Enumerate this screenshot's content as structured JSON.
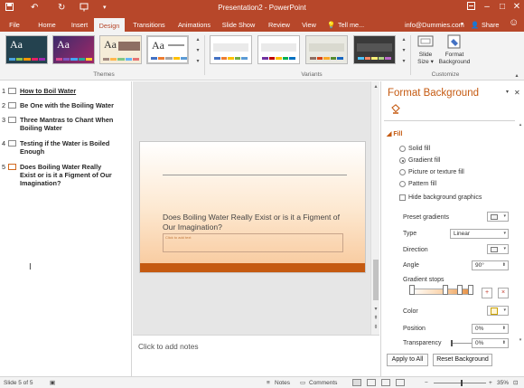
{
  "titlebar": {
    "title": "Presentation2 - PowerPoint",
    "qa_icons": [
      "save-icon",
      "undo-icon",
      "redo-icon",
      "present-icon",
      "customize-icon"
    ],
    "window_controls": [
      "restore-icon",
      "minimize-icon",
      "maximize-icon",
      "close-icon"
    ]
  },
  "tabs": [
    "File",
    "Home",
    "Insert",
    "Design",
    "Transitions",
    "Animations",
    "Slide Show",
    "Review",
    "View"
  ],
  "active_tab": "Design",
  "tell_me": "Tell me...",
  "account": "info@Dummies.com",
  "share": "Share",
  "ribbon": {
    "themes_label": "Themes",
    "variants_label": "Variants",
    "customize_label": "Customize",
    "theme_thumb_text": "Aa",
    "slide_size_label": "Slide Size",
    "slide_size_l1": "Slide",
    "slide_size_l2": "Size",
    "format_bg_l1": "Format",
    "format_bg_l2": "Background"
  },
  "outline": {
    "items": [
      {
        "num": "1",
        "text": "How to Boil Water"
      },
      {
        "num": "2",
        "text": "Be One with the Boiling Water"
      },
      {
        "num": "3",
        "text": "Three Mantras to Chant When Boiling Water"
      },
      {
        "num": "4",
        "text": "Testing if the Water is Boiled Enough"
      },
      {
        "num": "5",
        "text": "Does Boiling Water Really Exist or is it a Figment of Our Imagination?"
      }
    ],
    "selected": 5
  },
  "slide": {
    "title": "Does Boiling Water Really Exist or is it a Figment of Our Imagination?",
    "subtitle_placeholder": "Click to add text"
  },
  "notes_placeholder": "Click to add notes",
  "format_pane": {
    "title": "Format Background",
    "section": "Fill",
    "fill_options": [
      "Solid fill",
      "Gradient fill",
      "Picture or texture fill",
      "Pattern fill"
    ],
    "selected_fill": "Gradient fill",
    "hide_graphics": "Hide background graphics",
    "preset_gradients": "Preset gradients",
    "type_label": "Type",
    "type_value": "Linear",
    "direction_label": "Direction",
    "angle_label": "Angle",
    "angle_value": "90°",
    "gradient_stops": "Gradient stops",
    "color_label": "Color",
    "position_label": "Position",
    "position_value": "0%",
    "transparency_label": "Transparency",
    "transparency_value": "0%",
    "transparency_level": 0,
    "apply_all": "Apply to All",
    "reset": "Reset Background"
  },
  "status": {
    "slide_info": "Slide 5 of 5",
    "notes": "Notes",
    "comments": "Comments",
    "zoom": "35%",
    "zoom_level": 35
  },
  "colors": {
    "accent": "#b7472a",
    "pane_accent": "#c55a11"
  }
}
